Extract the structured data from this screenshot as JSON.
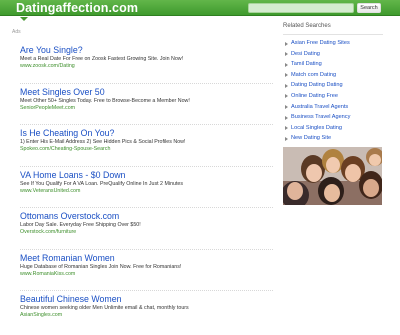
{
  "header": {
    "site_title": "Datingaffection.com",
    "search_placeholder": "",
    "search_button": "Search"
  },
  "ads_label": "Ads",
  "ads": [
    {
      "title": "Are You Single?",
      "desc": "Meet a Real Date For Free on Zoosk Fastest Growing Site. Join Now!",
      "url": "www.zoosk.com/Dating"
    },
    {
      "title": "Meet Singles Over 50",
      "desc": "Meet Other 50+ Singles Today. Free to Browse-Become a Member Now!",
      "url": "SeniorPeopleMeet.com"
    },
    {
      "title": "Is He Cheating On You?",
      "desc": "1) Enter His E-Mail Address 2) See Hidden Pics & Social Profiles Now!",
      "url": "Spokeo.com/Cheating-Spouse-Search"
    },
    {
      "title": "VA Home Loans - $0 Down",
      "desc": "See If You Qualify For A VA Loan. PreQualify Online In Just 2 Minutes",
      "url": "www.VeteransUnited.com"
    },
    {
      "title": "Ottomans Overstock.com",
      "desc": "Labor Day Sale. Everyday Free Shipping Over $50!",
      "url": "Overstock.com/furniture"
    },
    {
      "title": "Meet Romanian Women",
      "desc": "Huge Database of Romanian Singles Join Now. Free for Romanians!",
      "url": "www.RomaniaKiss.com"
    },
    {
      "title": "Beautiful Chinese Women",
      "desc": "Chinese women seeking older Men Unlimite email & chat, monthly tours",
      "url": "AsianSingles.com"
    }
  ],
  "sidebar": {
    "title": "Related Searches",
    "items": [
      "Asian Free Dating Sites",
      "Desi Dating",
      "Tamil Dating",
      "Match com Dating",
      "Dating Dating Dating",
      "Online Dating Free",
      "Australia Travel Agents",
      "Business Travel Agency",
      "Local Singles Dating",
      "New Dating Site"
    ]
  }
}
